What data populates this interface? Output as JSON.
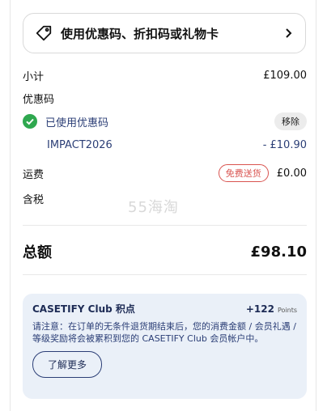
{
  "promo": {
    "label": "使用优惠码、折扣码或礼物卡",
    "icon": "tag-icon",
    "chevron_icon": "chevron-right-icon"
  },
  "summary": {
    "subtotal_label": "小计",
    "subtotal_value": "£109.00",
    "coupon_label": "优惠码",
    "applied_label": "已使用优惠码",
    "remove_label": "移除",
    "code": "IMPACT2026",
    "discount_value": "- £10.90",
    "shipping_label": "运费",
    "shipping_badge": "免费送货",
    "shipping_value": "£0.00",
    "tax_label": "含税",
    "total_label": "总额",
    "total_value": "£98.10"
  },
  "watermark": "55海淘",
  "club": {
    "title": "CASETIFY Club 积点",
    "points": "+122",
    "points_unit": "Points",
    "note": "请注意：在订单的无条件退货期结束后，您的消费金额 / 会员礼遇 / 等级奖励将会被累积到您的 CASETIFY Club 会员帐户中。",
    "learn_more": "了解更多"
  },
  "colors": {
    "accent": "#2b3e76",
    "success": "#2fa84f",
    "danger": "#d9534f",
    "club_bg": "#eaf0f8"
  }
}
